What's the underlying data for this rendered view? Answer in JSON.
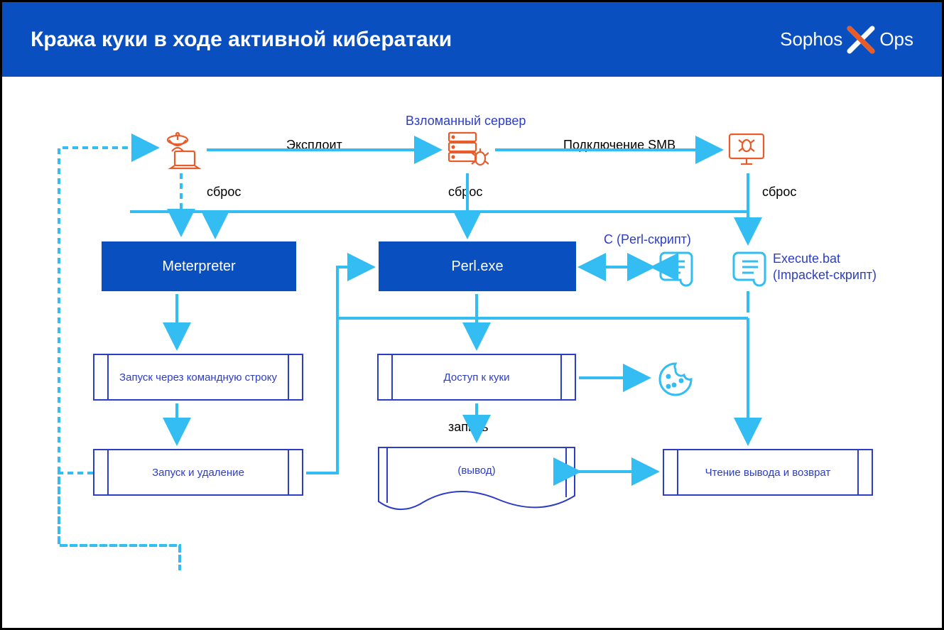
{
  "title": "Кража куки в ходе активной кибератаки",
  "logo": {
    "left": "Sophos",
    "right": "Ops"
  },
  "labels": {
    "hacked_server": "Взломанный сервер",
    "exploit": "Эксплоит",
    "smb": "Подключение SMB",
    "reset1": "сброс",
    "reset2": "сброс",
    "reset3": "сброс",
    "c_perl": "C (Perl-скрипт)",
    "exec_bat": "Execute.bat\n(Impacket-скрипт)",
    "write": "запись"
  },
  "nodes": {
    "meterpreter": "Meterpreter",
    "perl": "Perl.exe",
    "cmd_launch": "Запуск через командную строку",
    "launch_del": "Запуск и удаление",
    "cookie_access": "Доступ к куки",
    "output": "(вывод)",
    "read_return": "Чтение вывода и возврат"
  },
  "colors": {
    "brand": "#0a4fbf",
    "arrow": "#33bdf2",
    "outline": "#2d3dc4",
    "accent": "#e85c2a"
  }
}
